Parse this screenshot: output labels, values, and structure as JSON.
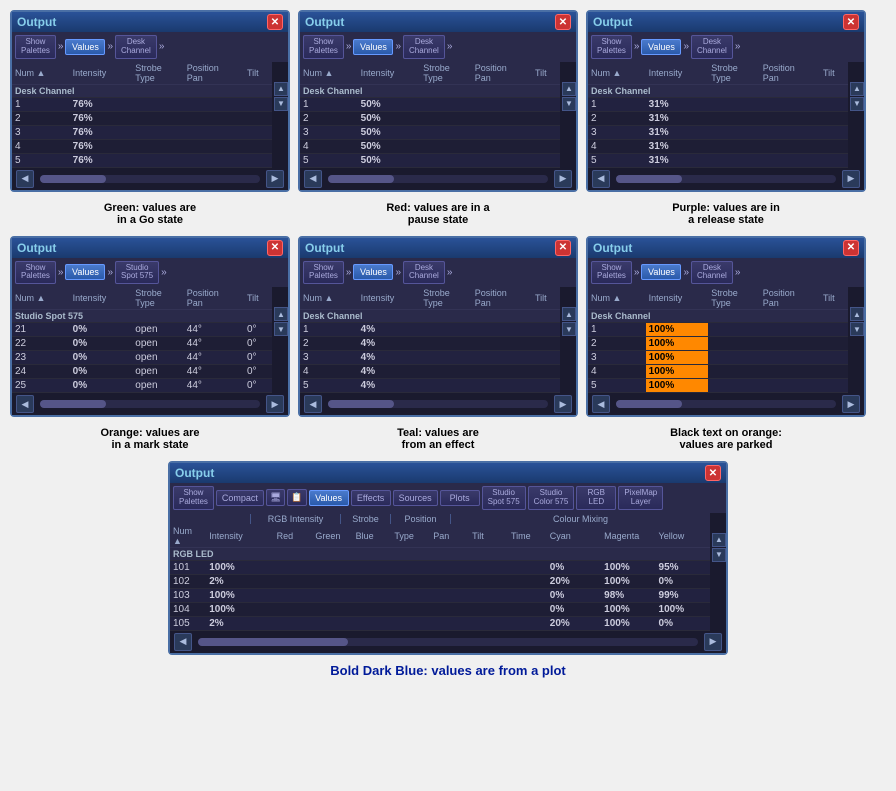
{
  "windows": {
    "top_left": {
      "title": "Output",
      "caption": "Green: values are in a Go state",
      "toolbar": {
        "show_palettes": "Show\nPalettes",
        "values": "Values",
        "desk_channel": "Desk\nChannel",
        "chevron": "»"
      },
      "columns": [
        "Num",
        "Intensity",
        "Strobe\nType",
        "Position\nPan",
        "Tilt"
      ],
      "section_header": "Desk Channel",
      "rows": [
        {
          "num": "1",
          "intensity": "76%",
          "val_class": "val-green"
        },
        {
          "num": "2",
          "intensity": "76%",
          "val_class": "val-green"
        },
        {
          "num": "3",
          "intensity": "76%",
          "val_class": "val-green"
        },
        {
          "num": "4",
          "intensity": "76%",
          "val_class": "val-green"
        },
        {
          "num": "5",
          "intensity": "76%",
          "val_class": "val-green"
        }
      ]
    },
    "top_mid": {
      "title": "Output",
      "caption": "Red: values are in a pause state",
      "section_header": "Desk Channel",
      "rows": [
        {
          "num": "1",
          "intensity": "50%",
          "val_class": "val-red"
        },
        {
          "num": "2",
          "intensity": "50%",
          "val_class": "val-red"
        },
        {
          "num": "3",
          "intensity": "50%",
          "val_class": "val-red"
        },
        {
          "num": "4",
          "intensity": "50%",
          "val_class": "val-red"
        },
        {
          "num": "5",
          "intensity": "50%",
          "val_class": "val-red"
        }
      ]
    },
    "top_right": {
      "title": "Output",
      "caption": "Purple: values are in a release state",
      "section_header": "Desk Channel",
      "rows": [
        {
          "num": "1",
          "intensity": "31%",
          "val_class": "val-purple"
        },
        {
          "num": "2",
          "intensity": "31%",
          "val_class": "val-purple"
        },
        {
          "num": "3",
          "intensity": "31%",
          "val_class": "val-purple"
        },
        {
          "num": "4",
          "intensity": "31%",
          "val_class": "val-purple"
        },
        {
          "num": "5",
          "intensity": "31%",
          "val_class": "val-purple"
        }
      ]
    },
    "mid_left": {
      "title": "Output",
      "caption": "Orange: values are in a mark state",
      "fixture_type": "Studio Spot 575",
      "section_header": "Studio Spot 575",
      "rows": [
        {
          "num": "21",
          "intensity": "0%",
          "strobe": "open",
          "pan": "44°",
          "tilt": "0°"
        },
        {
          "num": "22",
          "intensity": "0%",
          "strobe": "open",
          "pan": "44°",
          "tilt": "0°"
        },
        {
          "num": "23",
          "intensity": "0%",
          "strobe": "open",
          "pan": "44°",
          "tilt": "0°"
        },
        {
          "num": "24",
          "intensity": "0%",
          "strobe": "open",
          "pan": "44°",
          "tilt": "0°"
        },
        {
          "num": "25",
          "intensity": "0%",
          "strobe": "open",
          "pan": "44°",
          "tilt": "0°"
        }
      ]
    },
    "mid_center": {
      "title": "Output",
      "caption": "Teal: values are from an effect",
      "section_header": "Desk Channel",
      "rows": [
        {
          "num": "1",
          "intensity": "4%",
          "val_class": "val-teal"
        },
        {
          "num": "2",
          "intensity": "4%",
          "val_class": "val-teal"
        },
        {
          "num": "3",
          "intensity": "4%",
          "val_class": "val-teal"
        },
        {
          "num": "4",
          "intensity": "4%",
          "val_class": "val-teal"
        },
        {
          "num": "5",
          "intensity": "4%",
          "val_class": "val-teal"
        }
      ]
    },
    "mid_right": {
      "title": "Output",
      "caption": "Black text on orange: values are parked",
      "section_header": "Desk Channel",
      "rows": [
        {
          "num": "1",
          "intensity": "100%",
          "parked": true
        },
        {
          "num": "2",
          "intensity": "100%",
          "parked": true
        },
        {
          "num": "3",
          "intensity": "100%",
          "parked": true
        },
        {
          "num": "4",
          "intensity": "100%",
          "parked": true
        },
        {
          "num": "5",
          "intensity": "100%",
          "parked": true
        }
      ]
    },
    "bottom": {
      "title": "Output",
      "caption": "Bold Dark Blue: values are from a plot",
      "toolbar": {
        "show_palettes": "Show\nPalettes",
        "compact": "Compact",
        "values": "Values",
        "effects": "Effects",
        "sources": "Sources",
        "plots": "Plots",
        "studio_spot": "Studio\nSpot 575",
        "studio_color": "Studio\nColor 575",
        "rgb_led": "RGB\nLED",
        "pixelmap_layer": "PixelMap\nLayer"
      },
      "section_header": "RGB LED",
      "col_groups": {
        "rgb_intensity": "RGB Intensity",
        "strobe": "Strobe",
        "position": "Position",
        "colour_mixing": "Colour Mixing"
      },
      "columns": [
        "Num",
        "Intensity",
        "Red",
        "Green",
        "Blue",
        "Type",
        "Pan",
        "Tilt",
        "Time",
        "Cyan",
        "Magenta",
        "Yellow"
      ],
      "rows": [
        {
          "num": "101",
          "intensity": "100%",
          "cyan": "0%",
          "magenta": "100%",
          "yellow": "95%",
          "val_class": "val-blue-bold"
        },
        {
          "num": "102",
          "intensity": "2%",
          "cyan": "20%",
          "magenta": "100%",
          "yellow": "0%",
          "val_class": "val-blue-bold"
        },
        {
          "num": "103",
          "intensity": "100%",
          "cyan": "0%",
          "magenta": "98%",
          "yellow": "99%",
          "val_class": "val-blue-bold"
        },
        {
          "num": "104",
          "intensity": "100%",
          "cyan": "0%",
          "magenta": "100%",
          "yellow": "100%",
          "val_class": "val-blue-bold"
        },
        {
          "num": "105",
          "intensity": "2%",
          "cyan": "20%",
          "magenta": "100%",
          "yellow": "0%",
          "val_class": "val-blue-bold"
        }
      ]
    }
  },
  "labels": {
    "num": "Num",
    "intensity": "Intensity",
    "strobe_type": "Strobe\nType",
    "position_pan": "Position\nPan",
    "tilt": "Tilt",
    "output": "Output",
    "values": "Values",
    "desk_channel": "Desk Channel",
    "show_palettes": "Show\nPalettes",
    "chevron": "»",
    "close": "✕"
  }
}
